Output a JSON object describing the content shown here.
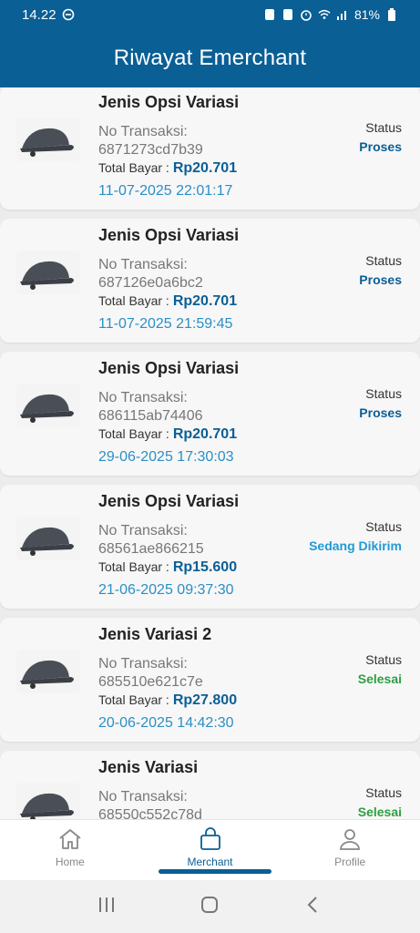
{
  "statusbar": {
    "time": "14.22",
    "battery": "81%"
  },
  "header": {
    "title": "Riwayat Emerchant"
  },
  "labels": {
    "trx": "No Transaksi:",
    "total": "Total Bayar :",
    "status": "Status"
  },
  "colors": {
    "primary": "#0a5f95",
    "proses": "#0a5f95",
    "dikirim": "#1e9bd7",
    "selesai": "#2ea043"
  },
  "transactions": [
    {
      "title": "Jenis Opsi Variasi",
      "trx_id": "6871273cd7b39",
      "amount": "Rp20.701",
      "date": "11-07-2025 22:01:17",
      "status": "Proses",
      "status_color": "#0a5f95"
    },
    {
      "title": "Jenis Opsi Variasi",
      "trx_id": "687126e0a6bc2",
      "amount": "Rp20.701",
      "date": "11-07-2025 21:59:45",
      "status": "Proses",
      "status_color": "#0a5f95"
    },
    {
      "title": "Jenis Opsi Variasi",
      "trx_id": "686115ab74406",
      "amount": "Rp20.701",
      "date": "29-06-2025 17:30:03",
      "status": "Proses",
      "status_color": "#0a5f95"
    },
    {
      "title": "Jenis Opsi Variasi",
      "trx_id": "68561ae866215",
      "amount": "Rp15.600",
      "date": "21-06-2025 09:37:30",
      "status": "Sedang Dikirim",
      "status_color": "#1e9bd7"
    },
    {
      "title": "Jenis Variasi 2",
      "trx_id": "685510e621c7e",
      "amount": "Rp27.800",
      "date": "20-06-2025 14:42:30",
      "status": "Selesai",
      "status_color": "#2ea043"
    },
    {
      "title": "Jenis Variasi",
      "trx_id": "68550c552c78d",
      "amount": "",
      "date": "",
      "status": "Selesai",
      "status_color": "#2ea043"
    }
  ],
  "bottom_nav": [
    {
      "label": "Home",
      "icon": "home-icon",
      "active": false
    },
    {
      "label": "Merchant",
      "icon": "shopping-bag-icon",
      "active": true
    },
    {
      "label": "Profile",
      "icon": "user-icon",
      "active": false
    }
  ],
  "system_nav": {
    "icons": [
      "recent-apps-icon",
      "home-circle-icon",
      "back-icon"
    ]
  }
}
